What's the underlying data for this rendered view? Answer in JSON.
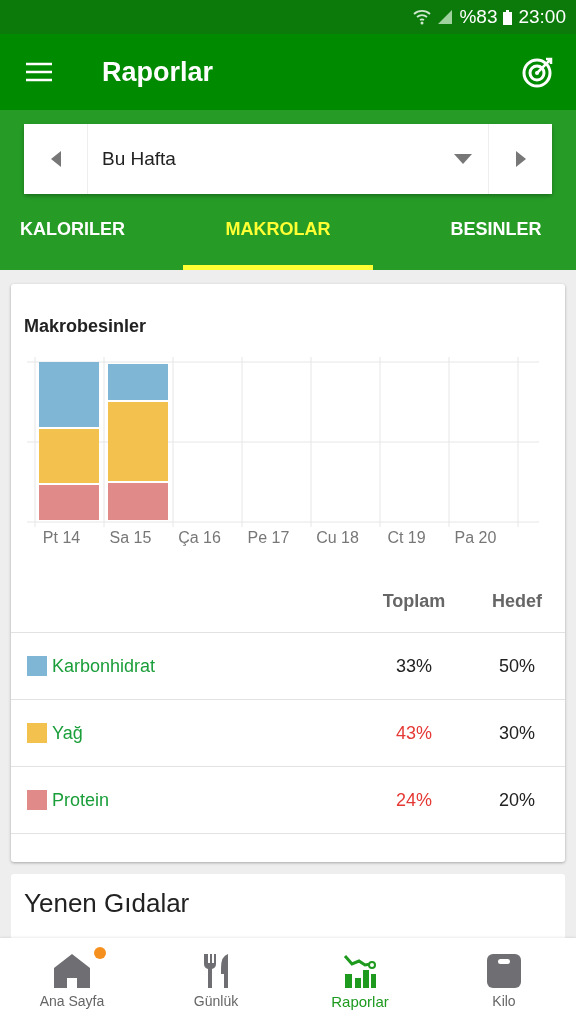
{
  "status_bar": {
    "battery": "%83",
    "time": "23:00"
  },
  "app_bar": {
    "title": "Raporlar"
  },
  "period_selector": {
    "value": "Bu Hafta"
  },
  "tabs": [
    {
      "label": "KALORILER",
      "selected": false
    },
    {
      "label": "MAKROLAR",
      "selected": true
    },
    {
      "label": "BESINLER",
      "selected": false
    }
  ],
  "macros_card": {
    "title": "Makrobesinler",
    "x_labels": [
      "Pt 14",
      "Sa 15",
      "Ça 16",
      "Pe 17",
      "Cu 18",
      "Ct 19",
      "Pa 20"
    ],
    "columns": [
      "Toplam",
      "Hedef"
    ],
    "rows": [
      {
        "name": "Karbonhidrat",
        "color": "#7fb5d5",
        "total": "33%",
        "over": false,
        "target": "50%"
      },
      {
        "name": "Yağ",
        "color": "#f2c14e",
        "total": "43%",
        "over": true,
        "target": "30%"
      },
      {
        "name": "Protein",
        "color": "#e08a8a",
        "total": "24%",
        "over": true,
        "target": "20%"
      }
    ]
  },
  "eaten_card": {
    "title": "Yenen Gıdalar"
  },
  "bottom_nav": [
    {
      "label": "Ana Sayfa",
      "kind": "home",
      "selected": false,
      "badge": true
    },
    {
      "label": "Günlük",
      "kind": "diary",
      "selected": false,
      "badge": false
    },
    {
      "label": "Raporlar",
      "kind": "reports",
      "selected": true,
      "badge": false
    },
    {
      "label": "Kilo",
      "kind": "weight",
      "selected": false,
      "badge": false
    }
  ]
}
